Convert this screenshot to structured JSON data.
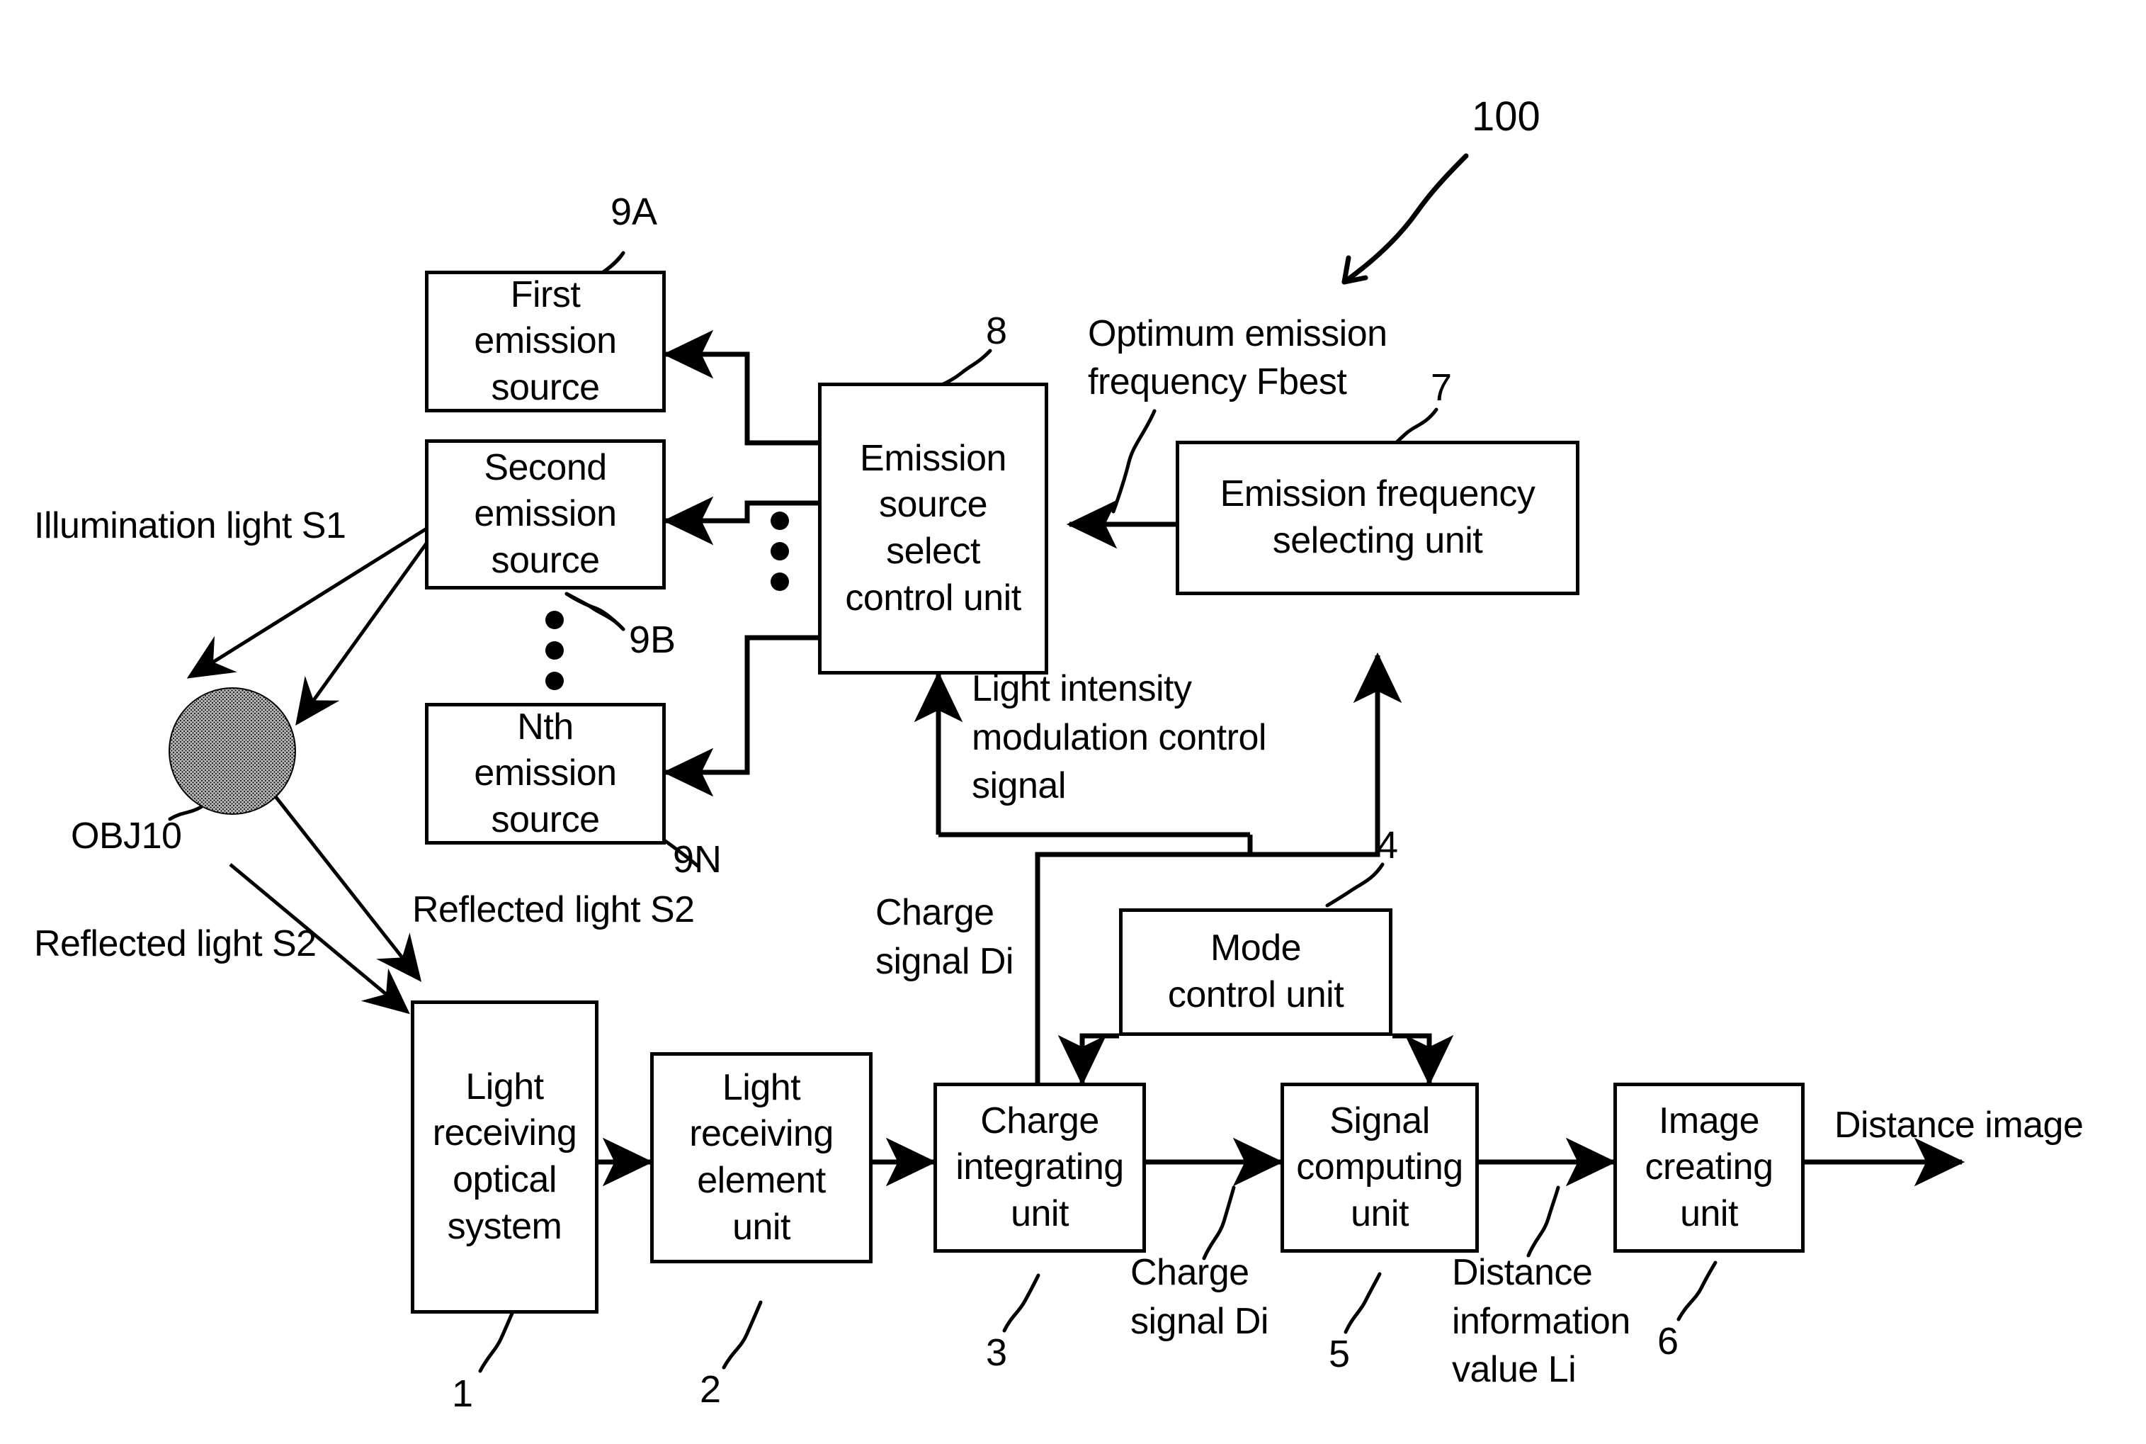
{
  "figure": {
    "system_number": "100",
    "boxes": {
      "first_emission_source": "First\nemission\nsource",
      "second_emission_source": "Second\nemission\nsource",
      "nth_emission_source": "Nth\nemission\nsource",
      "emission_source_select_control_unit": "Emission\nsource\nselect\ncontrol unit",
      "emission_frequency_selecting_unit": "Emission frequency\nselecting unit",
      "mode_control_unit": "Mode\ncontrol unit",
      "light_receiving_optical_system": "Light\nreceiving\noptical\nsystem",
      "light_receiving_element_unit": "Light\nreceiving\nelement\nunit",
      "charge_integrating_unit": "Charge\nintegrating\nunit",
      "signal_computing_unit": "Signal\ncomputing\nunit",
      "image_creating_unit": "Image\ncreating\nunit"
    },
    "reference_numerals": {
      "light_receiving_optical_system": "1",
      "light_receiving_element_unit": "2",
      "charge_integrating_unit": "3",
      "mode_control_unit": "4",
      "signal_computing_unit": "5",
      "image_creating_unit": "6",
      "emission_frequency_selecting_unit": "7",
      "emission_source_select_control_unit": "8",
      "first_emission_source": "9A",
      "second_emission_source": "9B",
      "nth_emission_source": "9N"
    },
    "annotations": {
      "illumination_light": "Illumination light S1",
      "reflected_light_left": "Reflected light S2",
      "reflected_light_right": "Reflected light S2",
      "object": "OBJ10",
      "optimum_emission_frequency": "Optimum emission\nfrequency Fbest",
      "light_intensity_modulation_control_signal": "Light intensity\nmodulation control\nsignal",
      "charge_signal_di_upper": "Charge\nsignal Di",
      "charge_signal_di_lower": "Charge\nsignal Di",
      "distance_information_value": "Distance\ninformation\nvalue Li",
      "distance_image": "Distance image"
    },
    "colors": {
      "line": "#000000",
      "background": "#ffffff",
      "object_fill": "#b7b7b7"
    }
  }
}
